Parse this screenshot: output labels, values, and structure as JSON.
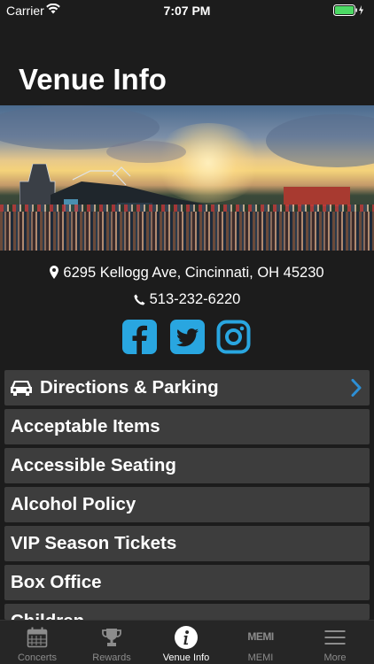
{
  "status_bar": {
    "carrier": "Carrier",
    "time": "7:07 PM"
  },
  "header": {
    "title": "Venue Info"
  },
  "venue": {
    "address": "6295 Kellogg Ave, Cincinnati, OH 45230",
    "phone": "513-232-6220"
  },
  "menu": {
    "items": [
      {
        "label": "Directions & Parking",
        "icon": "car-icon",
        "chevron": "chevron-right-icon"
      },
      {
        "label": "Acceptable Items"
      },
      {
        "label": "Accessible Seating"
      },
      {
        "label": "Alcohol Policy"
      },
      {
        "label": "VIP Season Tickets"
      },
      {
        "label": "Box Office"
      },
      {
        "label": "Children"
      }
    ]
  },
  "tab_bar": {
    "tabs": [
      {
        "label": "Concerts",
        "icon": "calendar-icon"
      },
      {
        "label": "Rewards",
        "icon": "trophy-icon"
      },
      {
        "label": "Venue Info",
        "icon": "info-icon",
        "active": true
      },
      {
        "label": "MEMI",
        "icon": "memi-logo",
        "logo_text": "MEMI"
      },
      {
        "label": "More",
        "icon": "menu-icon"
      }
    ]
  },
  "colors": {
    "accent": "#29a6e0",
    "chevron": "#2d8fd5",
    "background": "#1c1c1c",
    "row": "#3d3d3d"
  }
}
